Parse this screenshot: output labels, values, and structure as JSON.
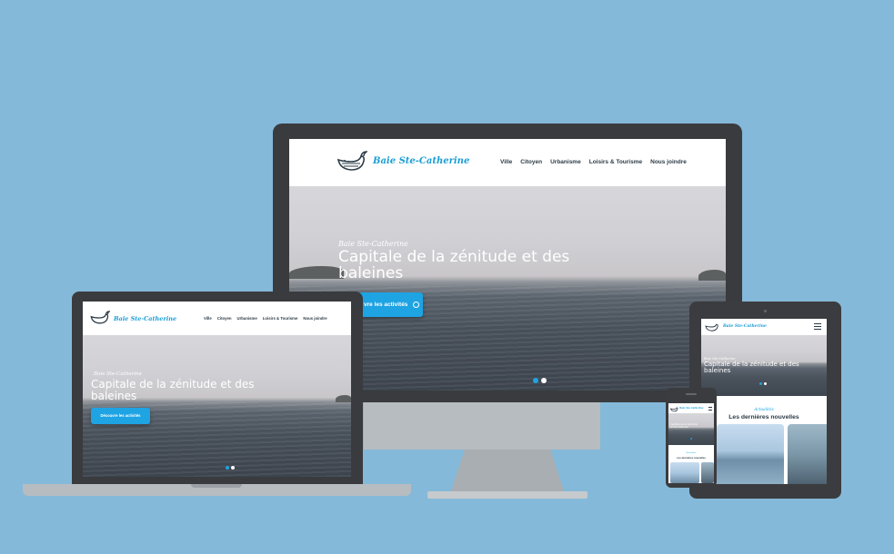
{
  "site": {
    "brand": "Baie Ste-Catherine",
    "nav": [
      "Ville",
      "Citoyen",
      "Urbanisme",
      "Loisirs & Tourisme",
      "Nous joindre"
    ],
    "hero": {
      "kicker": "Baie Ste-Catherine",
      "title": "Capitale de la zénitude et des baleines",
      "cta": "Découvre les activités",
      "cta_cropped": "vre les activités"
    },
    "news": {
      "kicker": "Actualités",
      "title": "Les dernières nouvelles"
    }
  },
  "colors": {
    "background": "#85b9d9",
    "accent": "#1ea3e3",
    "brand_text": "#1a9ed6",
    "device_frame": "#3b3c3f",
    "device_silver": "#b7bcc1"
  },
  "icons": [
    "whale-logo-icon",
    "hamburger-menu-icon",
    "arrow-circle-icon"
  ]
}
